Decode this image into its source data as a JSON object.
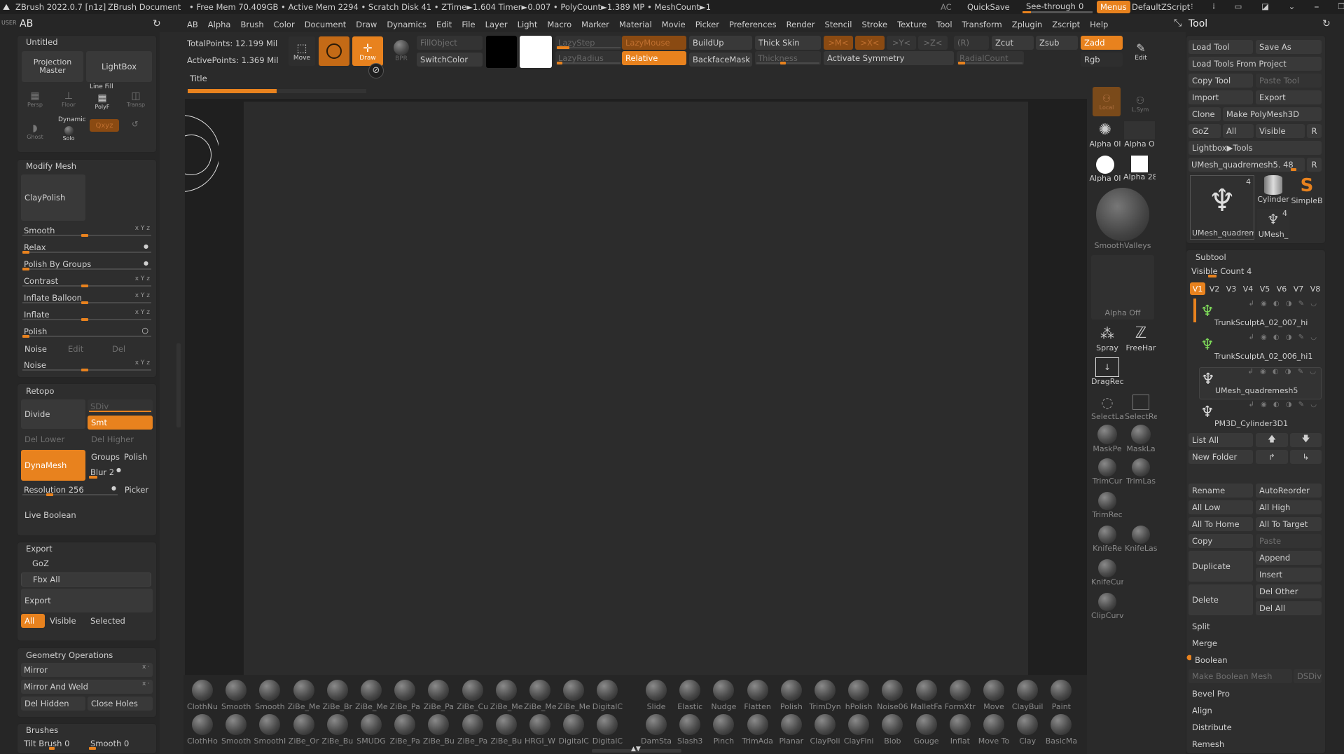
{
  "titlebar": {
    "app": "ZBrush 2022.0.7 [n1z]",
    "doc": "ZBrush Document",
    "stats": "• Free Mem 70.409GB • Active Mem 2294 • Scratch Disk 41 • ZTime►1.604 Timer►0.007 • PolyCount►1.389 MP • MeshCount►1",
    "ac": "AC",
    "quicksave": "QuickSave",
    "seethrough": "See-through",
    "seethrough_val": "0",
    "menus": "Menus",
    "zscript": "DefaultZScript"
  },
  "menubar": {
    "user": "USER",
    "ab": "AB",
    "items": [
      "AB",
      "Alpha",
      "Brush",
      "Color",
      "Document",
      "Draw",
      "Dynamics",
      "Edit",
      "File",
      "Layer",
      "Light",
      "Macro",
      "Marker",
      "Material",
      "Movie",
      "Picker",
      "Preferences",
      "Render",
      "Stencil",
      "Stroke",
      "Texture",
      "Tool",
      "Transform",
      "Zplugin",
      "Zscript",
      "Help"
    ]
  },
  "toolbar": {
    "total_points": "TotalPoints: 12.199 Mil",
    "active_points": "ActivePoints: 1.369 Mil",
    "move": "Move",
    "draw": "Draw",
    "bpr": "BPR",
    "fill_object": "FillObject",
    "switch_color": "SwitchColor",
    "lazy_step": "LazyStep",
    "lazy_radius": "LazyRadius",
    "lazy_mouse": "LazyMouse",
    "relative": "Relative",
    "build_up": "BuildUp",
    "backface_mask": "BackfaceMask",
    "thick_skin": "Thick Skin",
    "thickness": "Thickness",
    "mx": ">M<",
    "xx": ">X<",
    "yx": ">Y<",
    "zx": ">Z<",
    "r": "(R)",
    "activate_symmetry": "Activate Symmetry",
    "radial_count": "RadialCount",
    "zcut": "Zcut",
    "zsub": "Zsub",
    "zadd": "Zadd",
    "rgb": "Rgb",
    "edit": "Edit",
    "title_tab": "Title"
  },
  "left": {
    "untitled": "Untitled",
    "projection_master": "Projection Master",
    "lightbox": "LightBox",
    "persp": "Persp",
    "floor": "Floor",
    "line_fill": "Line Fill",
    "polyf": "PolyF",
    "transp": "Transp",
    "ghost": "Ghost",
    "dynamic": "Dynamic",
    "solo": "Solo",
    "xyz": "Qxyz",
    "modify_mesh": "Modify Mesh",
    "claypolish": "ClayPolish",
    "smooth": "Smooth",
    "relax": "Relax",
    "polish_by_groups": "Polish By Groups",
    "contrast": "Contrast",
    "inflate_balloon": "Inflate Balloon",
    "inflate": "Inflate",
    "polish": "Polish",
    "noise": "Noise",
    "edit": "Edit",
    "del": "Del",
    "noise2": "Noise",
    "xyz_lbl": "x Y z",
    "retopo": "Retopo",
    "divide": "Divide",
    "sdiv": "SDiv",
    "smt": "Smt",
    "del_lower": "Del Lower",
    "del_higher": "Del Higher",
    "dynamesh": "DynaMesh",
    "groups": "Groups",
    "polish2": "Polish",
    "blur": "Blur 2",
    "resolution": "Resolution 256",
    "picker": "Picker",
    "live_boolean": "Live Boolean",
    "export": "Export",
    "goz": "GoZ",
    "fbx_all": "Fbx All",
    "export_btn": "Export",
    "all": "All",
    "visible": "Visible",
    "selected": "Selected",
    "geometry_ops": "Geometry Operations",
    "mirror": "Mirror",
    "mirror_weld": "Mirror And Weld",
    "del_hidden": "Del Hidden",
    "close_holes": "Close Holes",
    "brushes": "Brushes",
    "tilt_brush": "Tilt Brush 0",
    "smooth0": "Smooth 0"
  },
  "shelf": {
    "local": "Local",
    "lsym": "L.Sym",
    "alpha01": "Alpha 0I",
    "alpha_o": "Alpha O",
    "alpha02": "Alpha 0I",
    "alpha28": "Alpha 28",
    "smoothvalleys": "SmoothValleys",
    "alpha_off": "Alpha Off",
    "spray": "Spray",
    "freehand": "FreeHar",
    "dragrect": "DragRec",
    "selectla": "SelectLa",
    "selectre": "SelectRe",
    "maskpe": "MaskPe",
    "maskla": "MaskLa",
    "trimcur": "TrimCur",
    "trimlas": "TrimLas",
    "trimrec": "TrimRec",
    "knifere": "KnifeRe",
    "knifelas": "KnifeLas",
    "knifecur": "KnifeCur",
    "clipcurv": "ClipCurv"
  },
  "brushbar": {
    "row1": [
      "ClothNu",
      "Smooth",
      "Smooth",
      "ZiBe_Me",
      "ZiBe_Br",
      "ZiBe_Me",
      "ZiBe_Pa",
      "ZiBe_Pa",
      "ZiBe_Cu",
      "ZiBe_Me",
      "ZiBe_Me",
      "ZiBe_Me",
      "DigitalC"
    ],
    "row1b": [
      "Slide",
      "Elastic",
      "Nudge",
      "Flatten",
      "Polish",
      "TrimDyn",
      "hPolish",
      "Noise06",
      "MalletFa",
      "FormXtr",
      "Move",
      "ClayBuil",
      "Paint"
    ],
    "row2": [
      "ClothHo",
      "Smooth",
      "SmoothI",
      "ZiBe_Or",
      "ZiBe_Bu",
      "SMUDG",
      "ZiBe_Pa",
      "ZiBe_Bu",
      "ZiBe_Pa",
      "ZiBe_Bu",
      "HRGI_W",
      "DigitalC",
      "DigitalC"
    ],
    "row2b": [
      "DamSta",
      "Slash3",
      "Pinch",
      "TrimAda",
      "Planar",
      "ClayPoli",
      "ClayFini",
      "Blob",
      "Gouge",
      "Inflat",
      "Move To",
      "Clay",
      "BasicMa"
    ]
  },
  "tool": {
    "title": "Tool",
    "load_tool": "Load Tool",
    "save_as": "Save As",
    "load_from_project": "Load Tools From Project",
    "copy_tool": "Copy Tool",
    "paste_tool": "Paste Tool",
    "import": "Import",
    "export": "Export",
    "clone": "Clone",
    "make_polymesh": "Make PolyMesh3D",
    "goz": "GoZ",
    "all": "All",
    "visible": "Visible",
    "r": "R",
    "lightbox_tools": "Lightbox▶Tools",
    "umesh_slider": "UMesh_quadremesh5. 48",
    "r2": "R",
    "thumb_count1": "4",
    "thumb_umesh": "UMesh_quadrem",
    "thumb_cylinder": "Cylinder",
    "thumb_simpleb": "SimpleB",
    "thumb_count2": "4",
    "thumb_umesh2": "UMesh_",
    "subtool": "Subtool",
    "visible_count": "Visible Count 4",
    "versions": [
      "V1",
      "V2",
      "V3",
      "V4",
      "V5",
      "V6",
      "V7",
      "V8"
    ],
    "subtools": [
      "TrunkSculptA_02_007_hi",
      "TrunkSculptA_02_006_hi1",
      "UMesh_quadremesh5",
      "PM3D_Cylinder3D1"
    ],
    "list_all": "List All",
    "new_folder": "New Folder",
    "rename": "Rename",
    "autoreorder": "AutoReorder",
    "all_low": "All Low",
    "all_high": "All High",
    "all_to_home": "All To Home",
    "all_to_target": "All To Target",
    "copy": "Copy",
    "paste": "Paste",
    "duplicate": "Duplicate",
    "append": "Append",
    "insert": "Insert",
    "delete": "Delete",
    "del_other": "Del Other",
    "del_all": "Del All",
    "split": "Split",
    "merge": "Merge",
    "boolean": "Boolean",
    "make_boolean_mesh": "Make Boolean Mesh",
    "dsdiv": "DSDiv",
    "bevel_pro": "Bevel Pro",
    "align": "Align",
    "distribute": "Distribute",
    "remesh": "Remesh"
  }
}
